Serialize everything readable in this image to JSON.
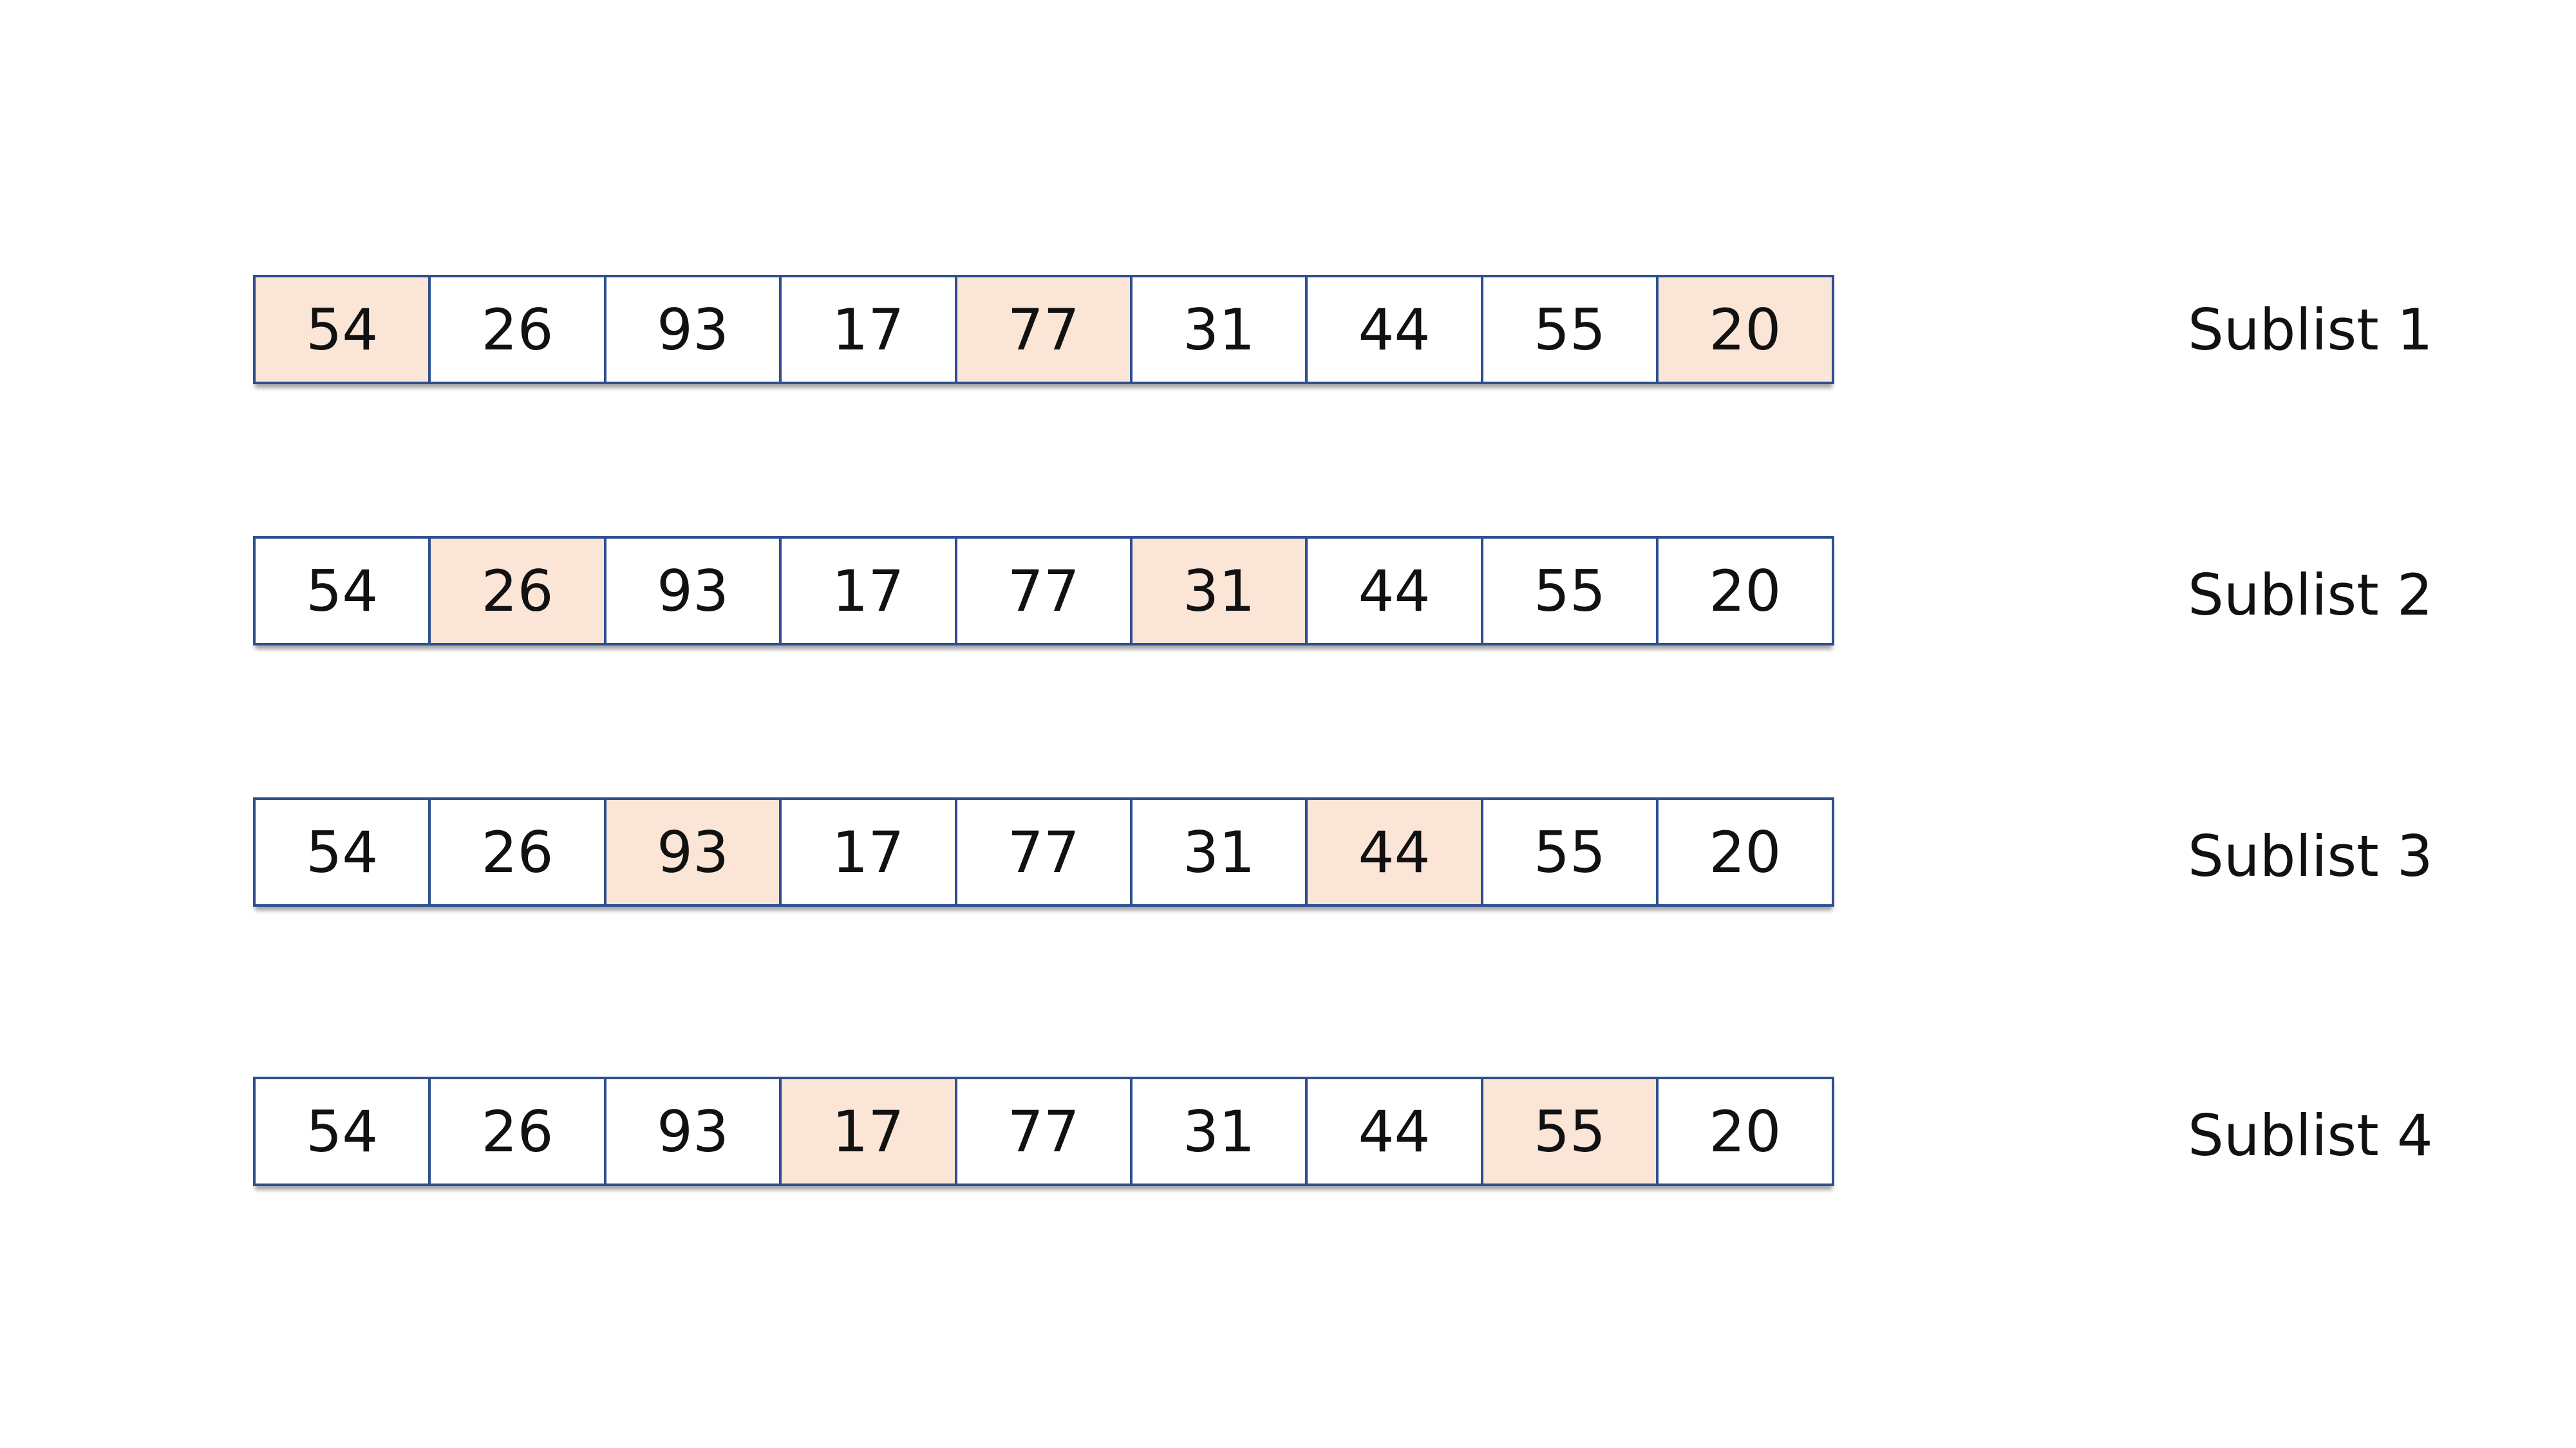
{
  "values": [
    "54",
    "26",
    "93",
    "17",
    "77",
    "31",
    "44",
    "55",
    "20"
  ],
  "highlight_color": "#fbe5d6",
  "border_color": "#2f4f8f",
  "sublists": [
    {
      "label": "Sublist 1",
      "highlighted": [
        0,
        4,
        8
      ]
    },
    {
      "label": "Sublist 2",
      "highlighted": [
        1,
        5
      ]
    },
    {
      "label": "Sublist 3",
      "highlighted": [
        2,
        6
      ]
    },
    {
      "label": "Sublist 4",
      "highlighted": [
        3,
        7
      ]
    }
  ]
}
